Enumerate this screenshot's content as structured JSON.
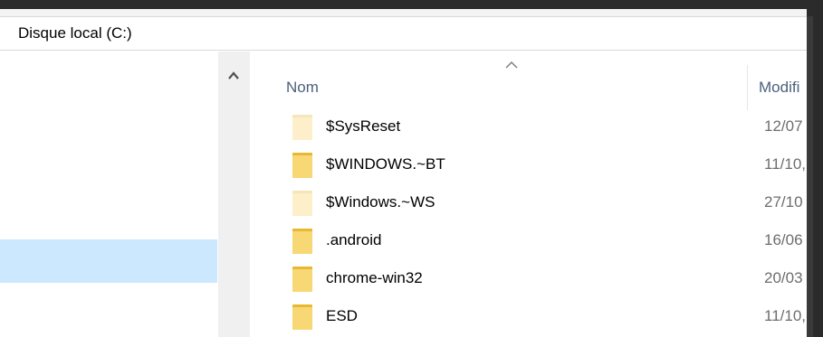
{
  "address_bar": {
    "path": "Disque local (C:)"
  },
  "nav_pane": {
    "scroll_up_icon": "chevron-up-icon"
  },
  "file_list": {
    "sort_icon": "sort-ascending-icon",
    "columns": {
      "name": "Nom",
      "modified": "Modifi"
    },
    "rows": [
      {
        "name": "$SysReset",
        "date": "12/07",
        "icon": "folder-icon",
        "hidden": true
      },
      {
        "name": "$WINDOWS.~BT",
        "date": "11/10,",
        "icon": "folder-icon",
        "hidden": false
      },
      {
        "name": "$Windows.~WS",
        "date": "27/10",
        "icon": "folder-icon",
        "hidden": true
      },
      {
        "name": ".android",
        "date": "16/06",
        "icon": "folder-icon",
        "hidden": false
      },
      {
        "name": "chrome-win32",
        "date": "20/03",
        "icon": "folder-icon",
        "hidden": false
      },
      {
        "name": "ESD",
        "date": "11/10,",
        "icon": "folder-icon",
        "hidden": false
      }
    ]
  },
  "colors": {
    "frame": "#2b2b2b",
    "selection": "#cce8ff",
    "header_text": "#4c607a",
    "folder": "#f8d775",
    "folder_hidden": "#fcefc9"
  }
}
